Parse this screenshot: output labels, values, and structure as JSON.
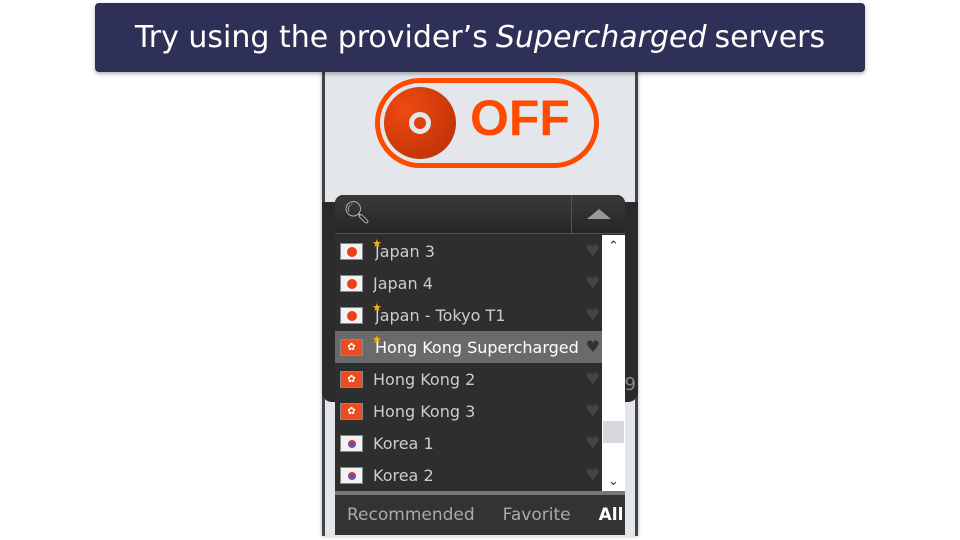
{
  "banner": {
    "pre": "Try using the provider’s",
    "em": "Supercharged",
    "post": "servers"
  },
  "toggle": {
    "label": "OFF",
    "state": "off",
    "color": "#ff4a00"
  },
  "background_panel": {
    "partial_text": "9"
  },
  "search": {
    "icon": "search-icon",
    "placeholder": ""
  },
  "servers": [
    {
      "name": "Japan 3",
      "flag": "jp",
      "starred": true
    },
    {
      "name": "Japan 4",
      "flag": "jp",
      "starred": false
    },
    {
      "name": "Japan - Tokyo T1",
      "flag": "jp",
      "starred": true
    },
    {
      "name": "Hong Kong Supercharged",
      "flag": "hk",
      "starred": true,
      "selected": true
    },
    {
      "name": "Hong Kong 2",
      "flag": "hk",
      "starred": false
    },
    {
      "name": "Hong Kong 3",
      "flag": "hk",
      "starred": false
    },
    {
      "name": "Korea 1",
      "flag": "kr",
      "starred": false
    },
    {
      "name": "Korea 2",
      "flag": "kr",
      "starred": false
    }
  ],
  "tabs": {
    "recommended": "Recommended",
    "favorite": "Favorite",
    "all": "All",
    "active": "All"
  }
}
